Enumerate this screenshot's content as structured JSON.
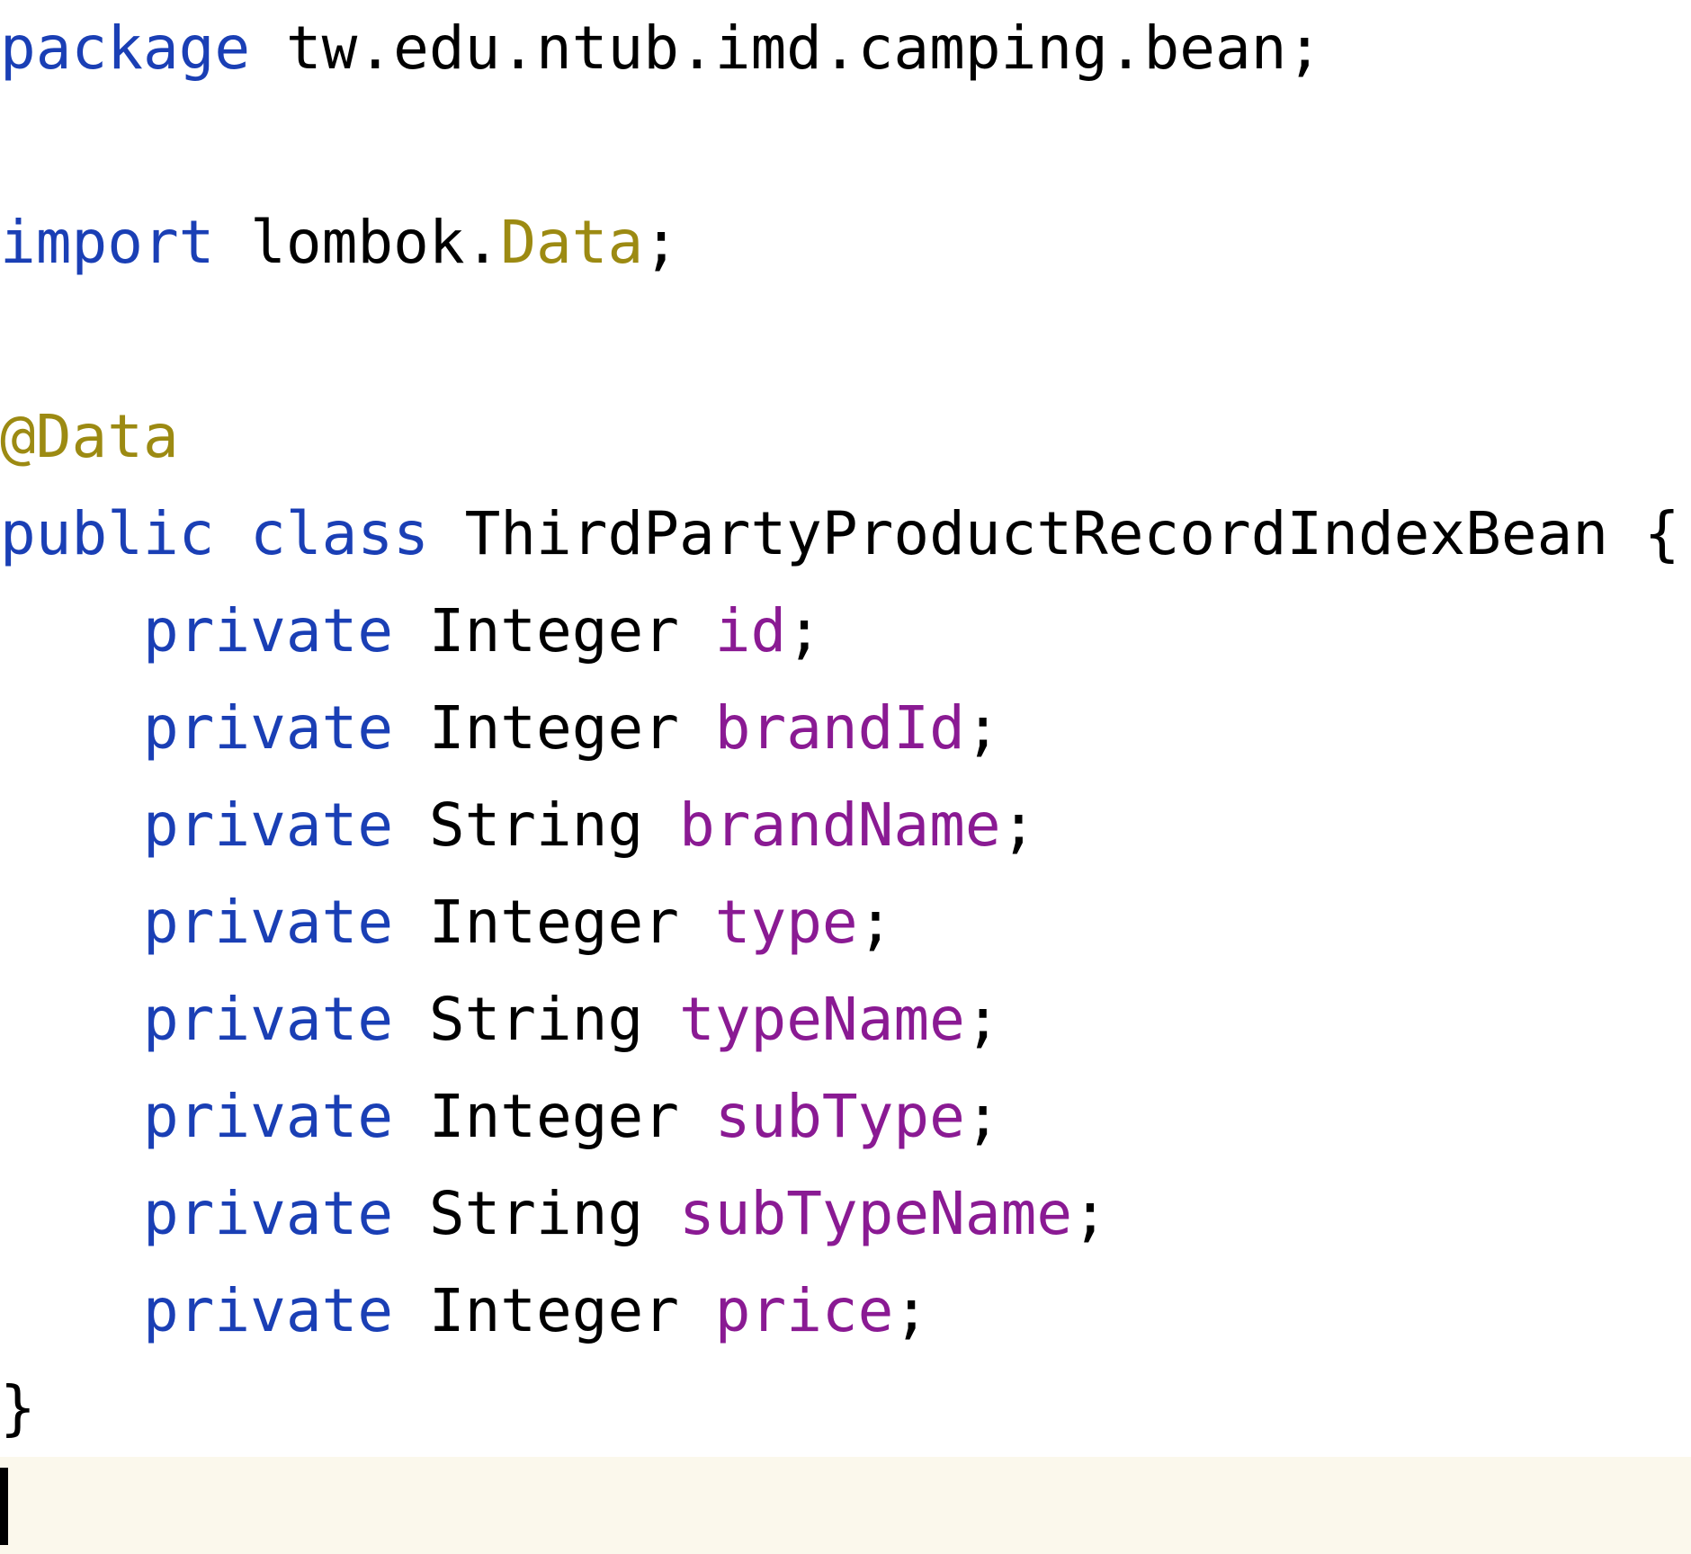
{
  "editor": {
    "language": "java",
    "lines": [
      {
        "tokens": [
          {
            "text": "package",
            "kind": "kw"
          },
          {
            "text": " tw.edu.ntub.imd.camping.bean;",
            "kind": "plain"
          }
        ]
      },
      {
        "tokens": []
      },
      {
        "tokens": [
          {
            "text": "import",
            "kind": "kw"
          },
          {
            "text": " lombok.",
            "kind": "plain"
          },
          {
            "text": "Data",
            "kind": "ann"
          },
          {
            "text": ";",
            "kind": "plain"
          }
        ]
      },
      {
        "tokens": []
      },
      {
        "tokens": [
          {
            "text": "@Data",
            "kind": "ann"
          }
        ]
      },
      {
        "tokens": [
          {
            "text": "public class",
            "kind": "kw"
          },
          {
            "text": " ThirdPartyProductRecordIndexBean {",
            "kind": "plain"
          }
        ]
      },
      {
        "tokens": [
          {
            "text": "    private",
            "kind": "kw"
          },
          {
            "text": " Integer ",
            "kind": "plain"
          },
          {
            "text": "id",
            "kind": "field"
          },
          {
            "text": ";",
            "kind": "plain"
          }
        ]
      },
      {
        "tokens": [
          {
            "text": "    private",
            "kind": "kw"
          },
          {
            "text": " Integer ",
            "kind": "plain"
          },
          {
            "text": "brandId",
            "kind": "field"
          },
          {
            "text": ";",
            "kind": "plain"
          }
        ]
      },
      {
        "tokens": [
          {
            "text": "    private",
            "kind": "kw"
          },
          {
            "text": " String ",
            "kind": "plain"
          },
          {
            "text": "brandName",
            "kind": "field"
          },
          {
            "text": ";",
            "kind": "plain"
          }
        ]
      },
      {
        "tokens": [
          {
            "text": "    private",
            "kind": "kw"
          },
          {
            "text": " Integer ",
            "kind": "plain"
          },
          {
            "text": "type",
            "kind": "field"
          },
          {
            "text": ";",
            "kind": "plain"
          }
        ]
      },
      {
        "tokens": [
          {
            "text": "    private",
            "kind": "kw"
          },
          {
            "text": " String ",
            "kind": "plain"
          },
          {
            "text": "typeName",
            "kind": "field"
          },
          {
            "text": ";",
            "kind": "plain"
          }
        ]
      },
      {
        "tokens": [
          {
            "text": "    private",
            "kind": "kw"
          },
          {
            "text": " Integer ",
            "kind": "plain"
          },
          {
            "text": "subType",
            "kind": "field"
          },
          {
            "text": ";",
            "kind": "plain"
          }
        ]
      },
      {
        "tokens": [
          {
            "text": "    private",
            "kind": "kw"
          },
          {
            "text": " String ",
            "kind": "plain"
          },
          {
            "text": "subTypeName",
            "kind": "field"
          },
          {
            "text": ";",
            "kind": "plain"
          }
        ]
      },
      {
        "tokens": [
          {
            "text": "    private",
            "kind": "kw"
          },
          {
            "text": " Integer ",
            "kind": "plain"
          },
          {
            "text": "price",
            "kind": "field"
          },
          {
            "text": ";",
            "kind": "plain"
          }
        ]
      },
      {
        "tokens": [
          {
            "text": "}",
            "kind": "plain"
          }
        ]
      },
      {
        "tokens": []
      }
    ]
  },
  "colors": {
    "keyword": "#1a3fb5",
    "annotation": "#9c8a12",
    "field": "#8a1a93",
    "text": "#000000",
    "current_line_highlight": "#fbf8ec"
  }
}
